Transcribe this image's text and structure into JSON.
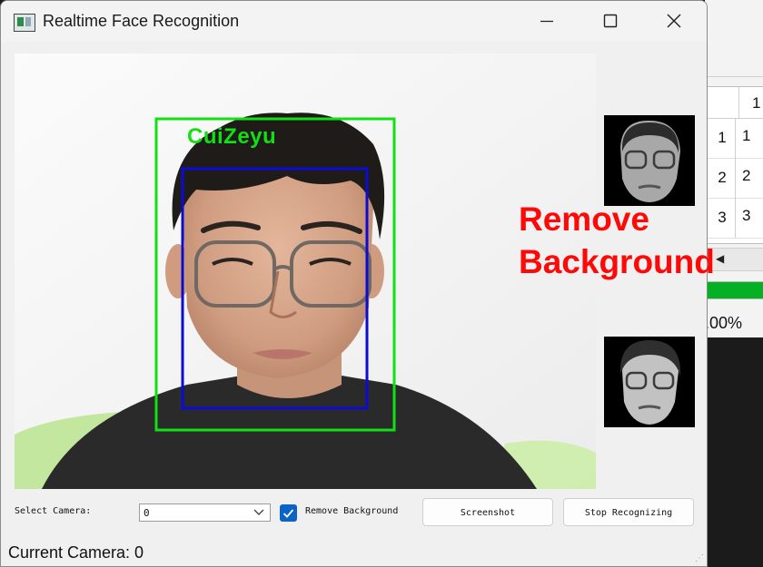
{
  "window": {
    "title": "Realtime Face Recognition",
    "icons": {
      "app": "app-icon",
      "minimize": "minimize-icon",
      "maximize": "maximize-icon",
      "close": "close-icon"
    }
  },
  "video": {
    "detection_label": "CuiZeyu",
    "colors": {
      "outer_box": "#13e013",
      "inner_box": "#0b0bd4"
    }
  },
  "side_panel": {
    "caption": "Remove Background"
  },
  "controls": {
    "select_camera_label": "Select Camera:",
    "camera_value": "0",
    "remove_bg_label": "Remove Background",
    "remove_bg_checked": true,
    "screenshot_label": "Screenshot",
    "stop_label": "Stop Recognizing"
  },
  "status": {
    "text": "Current Camera: 0"
  },
  "background_app": {
    "header_value": "1",
    "rows": [
      {
        "index": "1",
        "value": "1"
      },
      {
        "index": "2",
        "value": "2"
      },
      {
        "index": "3",
        "value": "3"
      }
    ],
    "progress_text": ".00%",
    "accent": "#06b025"
  }
}
